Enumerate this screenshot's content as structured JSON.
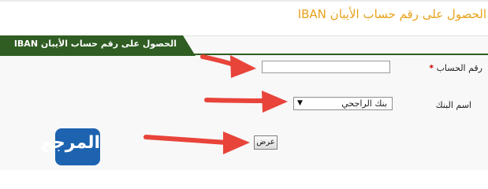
{
  "page": {
    "title": "الحصول على رقم حساب الأيبان IBAN"
  },
  "panel": {
    "header": "الحصول على رقم حساب الأيبان IBAN"
  },
  "form": {
    "account_number": {
      "label": "رقم الحساب",
      "required_mark": "*",
      "value": ""
    },
    "bank_name": {
      "label": "اسم البنك",
      "selected": "بنك الراجحي",
      "arrow": "▼"
    },
    "submit_label": "عرض"
  },
  "watermark": {
    "logo_text": "المرجع"
  },
  "colors": {
    "title": "#e7a21c",
    "header_bg": "#2f5d22",
    "arrow": "#e8443a",
    "logo": "#1d63b0"
  },
  "icons": [
    "pointer-arrow-icon",
    "dropdown-arrow-icon"
  ]
}
